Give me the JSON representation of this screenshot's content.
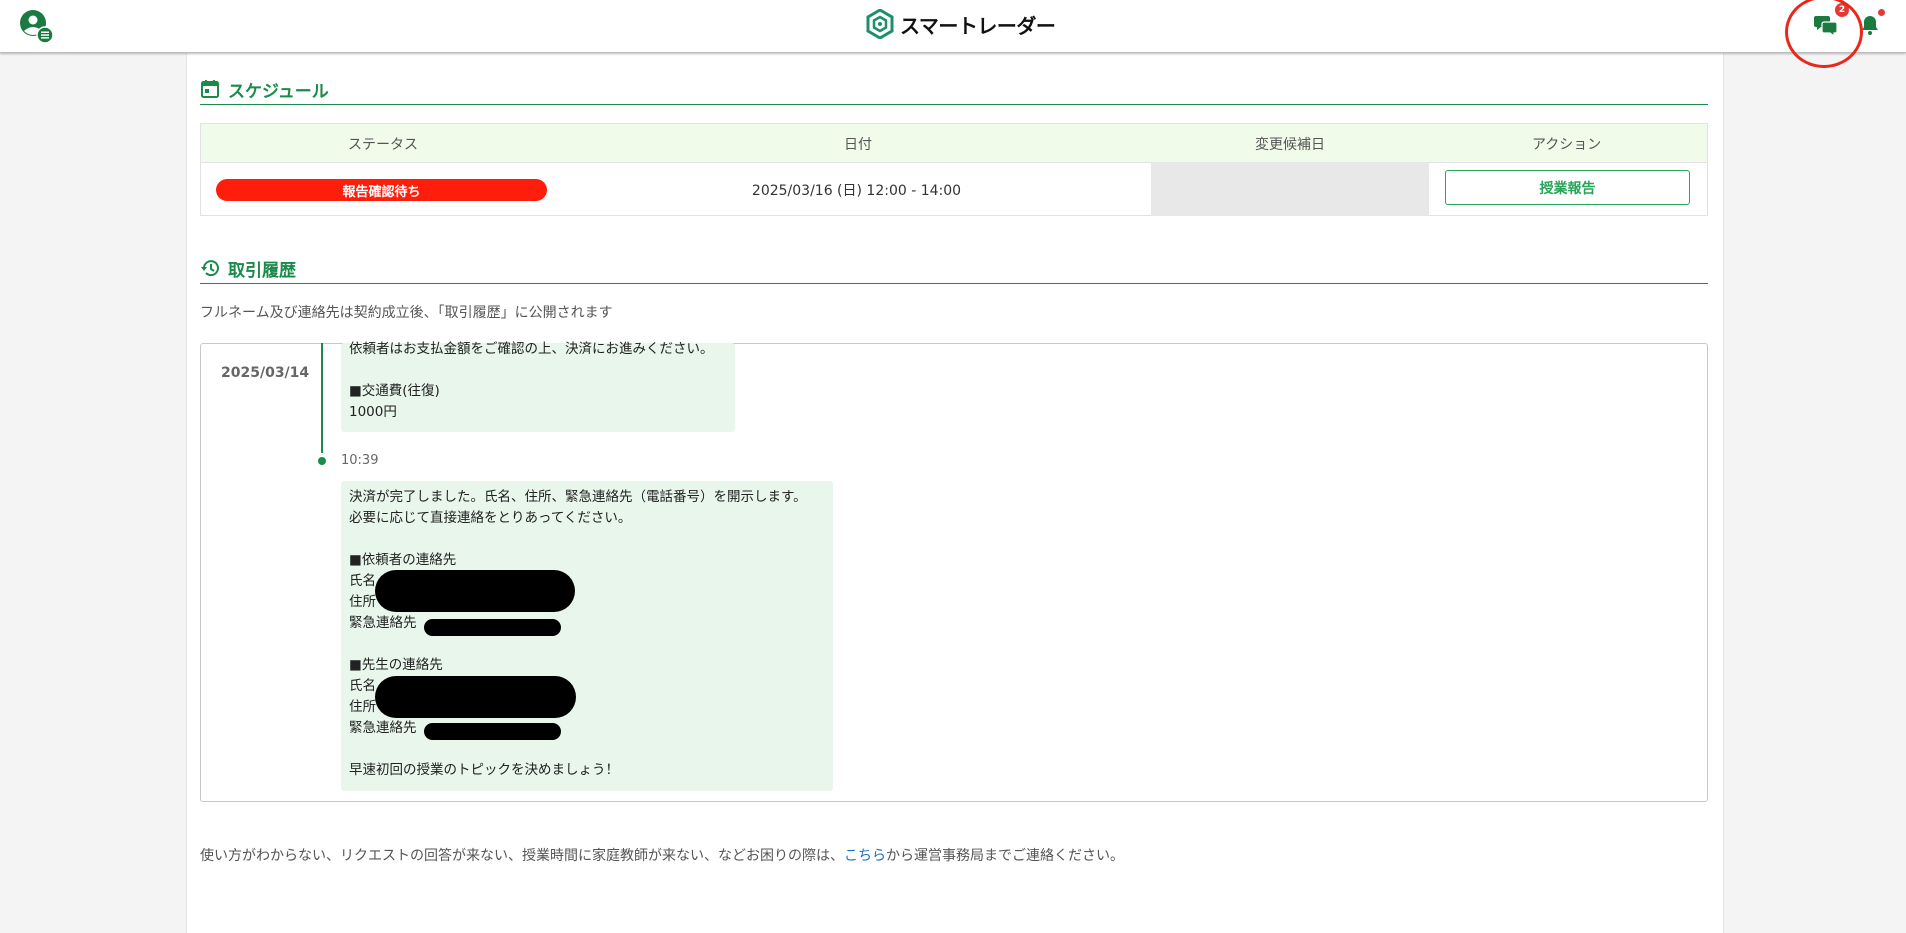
{
  "header": {
    "logo_text": "スマートレーダー",
    "chat_badge_count": "2",
    "icons": {
      "user": "user-menu-icon",
      "chat": "chat-bubbles-icon",
      "bell": "bell-icon"
    }
  },
  "schedule": {
    "title": "スケジュール",
    "columns": [
      "ステータス",
      "日付",
      "変更候補日",
      "アクション"
    ],
    "row": {
      "status": "報告確認待ち",
      "date": "2025/03/16 (日) 12:00 - 14:00",
      "candidate": "",
      "action": "授業報告"
    }
  },
  "history": {
    "title": "取引履歴",
    "note": "フルネーム及び連絡先は契約成立後、「取引履歴」に公開されます",
    "date": "2025/03/14",
    "message1": [
      "依頼者はお支払金額をご確認の上、決済にお進みください。",
      "",
      "■交通費(往復)",
      "1000円"
    ],
    "message2_time": "10:39",
    "message2": [
      "決済が完了しました。氏名、住所、緊急連絡先（電話番号）を開示します。",
      "必要に応じて直接連絡をとりあってください。",
      "",
      "■依頼者の連絡先",
      "氏名",
      "住所",
      "緊急連絡先",
      "",
      "■先生の連絡先",
      "氏名",
      "住所",
      "緊急連絡先",
      "",
      "早速初回の授業のトピックを決めましょう！"
    ]
  },
  "footer": {
    "help_prefix": "使い方がわからない、リクエストの回答が来ない、授業時間に家庭教師が来ない、などお困りの際は、",
    "help_link": "こちら",
    "help_suffix": "から運営事務局までご連絡ください。"
  },
  "colors": {
    "accent_green": "#1b8a4a",
    "status_red": "#ff1d0c",
    "link_blue": "#1a73c8"
  }
}
